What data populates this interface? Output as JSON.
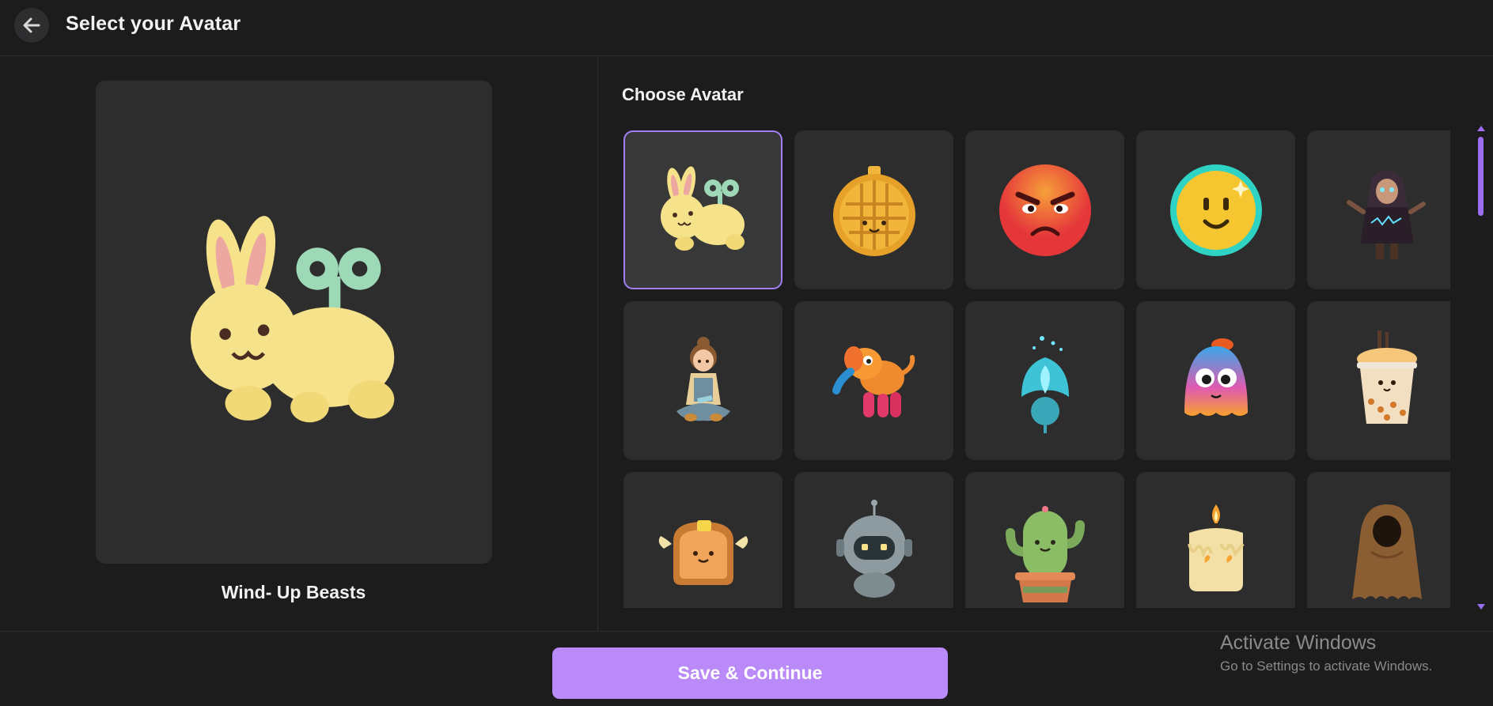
{
  "header": {
    "title": "Select your Avatar",
    "back_icon": "arrow-left-icon"
  },
  "preview": {
    "name": "Wind- Up Beasts"
  },
  "chooser": {
    "title": "Choose Avatar",
    "selected_index": 0,
    "avatars": [
      {
        "icon": "windup-bunny-icon"
      },
      {
        "icon": "waffle-icon"
      },
      {
        "icon": "angry-face-icon"
      },
      {
        "icon": "smiley-coin-icon"
      },
      {
        "icon": "hooded-wizard-icon"
      },
      {
        "icon": "sitting-girl-icon"
      },
      {
        "icon": "balloon-elephant-icon"
      },
      {
        "icon": "glowing-flower-icon"
      },
      {
        "icon": "jelly-blob-icon"
      },
      {
        "icon": "boba-tea-icon"
      },
      {
        "icon": "winged-toast-icon"
      },
      {
        "icon": "robot-icon"
      },
      {
        "icon": "cactus-icon"
      },
      {
        "icon": "candle-icon"
      },
      {
        "icon": "cloak-ghost-icon"
      }
    ]
  },
  "footer": {
    "save_label": "Save & Continue"
  },
  "watermark": {
    "title": "Activate Windows",
    "subtitle": "Go to Settings to activate Windows."
  },
  "colors": {
    "accent": "#b98af8",
    "background": "#1c1c1d",
    "card": "#2d2d2e"
  }
}
